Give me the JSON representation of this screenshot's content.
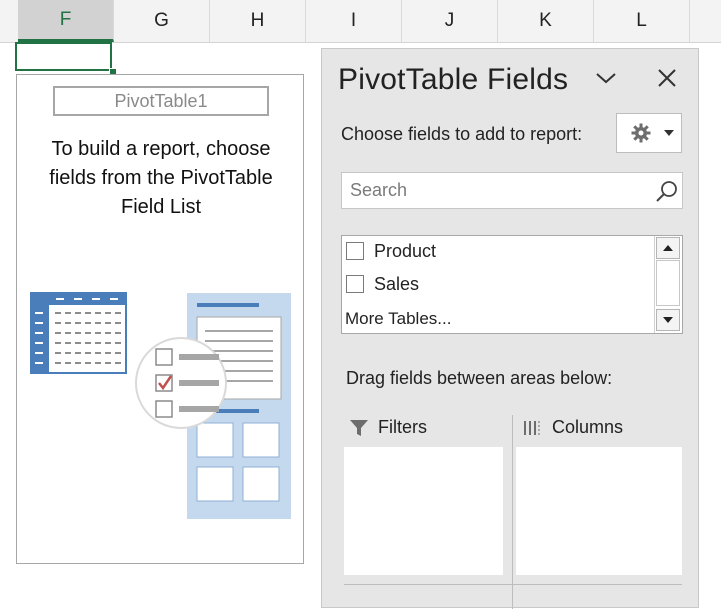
{
  "columns": [
    "F",
    "G",
    "H",
    "I",
    "J",
    "K",
    "L"
  ],
  "pivot_placeholder": {
    "name": "PivotTable1",
    "hint": "To build a report, choose fields from the PivotTable Field List"
  },
  "pane": {
    "title": "PivotTable Fields",
    "choose_label": "Choose fields to add to report:",
    "search_placeholder": "Search",
    "fields": [
      {
        "label": "Product",
        "checked": false
      },
      {
        "label": "Sales",
        "checked": false
      }
    ],
    "more_tables": "More Tables...",
    "drag_label": "Drag fields between areas below:",
    "areas": {
      "filters": "Filters",
      "columns": "Columns"
    }
  },
  "colors": {
    "accent": "#217346",
    "pane_bg": "#e6e6e6",
    "illustration_blue": "#4a7ebb",
    "illustration_light": "#c5d9ee",
    "check_red": "#c0504d"
  },
  "icons": [
    "chevron-down-icon",
    "close-icon",
    "gear-icon",
    "dropdown-caret-icon",
    "search-icon",
    "scroll-up-icon",
    "scroll-down-icon",
    "filter-icon",
    "columns-icon"
  ]
}
